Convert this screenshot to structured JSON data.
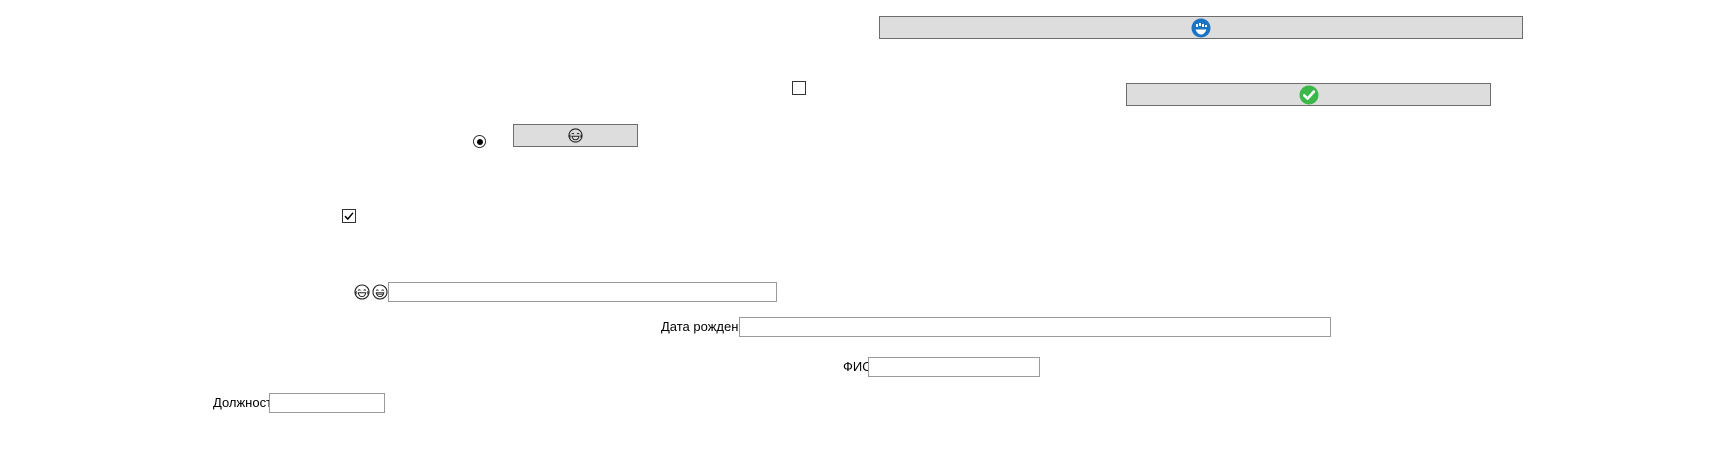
{
  "buttons": {
    "top_wide": {
      "icon": "blue-smile-icon"
    },
    "check": {
      "icon": "green-checkmark-icon"
    },
    "small": {
      "icon": "laughing-face-icon"
    }
  },
  "checkboxes": {
    "upper": {
      "checked": false
    },
    "lower": {
      "checked": true
    }
  },
  "radio": {
    "selected": true
  },
  "emoji_row": {
    "icons": [
      "laughing-face-icon",
      "grinning-face-icon"
    ],
    "input_value": ""
  },
  "form": {
    "birth_date_label": "Дата рождения",
    "birth_date_value": "",
    "full_name_label": "ФИО",
    "full_name_value": "",
    "position_label": "Должность",
    "position_value": ""
  },
  "colors": {
    "button_bg": "#dddddd",
    "accent_blue": "#1b73c4",
    "accent_green": "#3cb84a"
  }
}
